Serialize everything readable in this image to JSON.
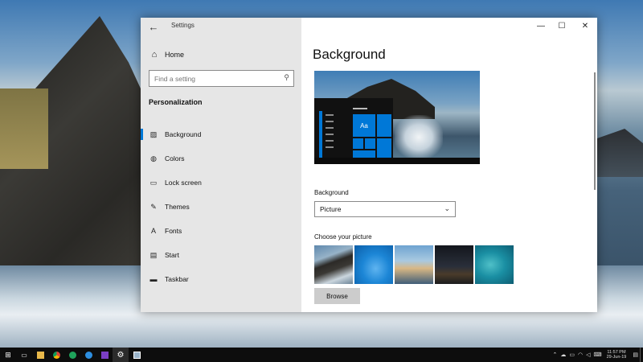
{
  "window": {
    "app_title": "Settings",
    "controls": {
      "minimize": "—",
      "maximize": "☐",
      "close": "✕"
    }
  },
  "sidebar": {
    "home_label": "Home",
    "search_placeholder": "Find a setting",
    "section_title": "Personalization",
    "items": [
      {
        "label": "Background",
        "icon": "picture-icon",
        "active": true
      },
      {
        "label": "Colors",
        "icon": "palette-icon",
        "active": false
      },
      {
        "label": "Lock screen",
        "icon": "lock-screen-icon",
        "active": false
      },
      {
        "label": "Themes",
        "icon": "themes-icon",
        "active": false
      },
      {
        "label": "Fonts",
        "icon": "fonts-icon",
        "active": false
      },
      {
        "label": "Start",
        "icon": "start-icon",
        "active": false
      },
      {
        "label": "Taskbar",
        "icon": "taskbar-icon",
        "active": false
      }
    ]
  },
  "main": {
    "title": "Background",
    "preview": {
      "tile_text": "Aa"
    },
    "background_label": "Background",
    "background_value": "Picture",
    "choose_label": "Choose your picture",
    "browse_label": "Browse"
  },
  "taskbar": {
    "clock_time": "11:57 PM",
    "clock_date": "29-Jun-19"
  },
  "colors": {
    "accent": "#0078d7"
  }
}
